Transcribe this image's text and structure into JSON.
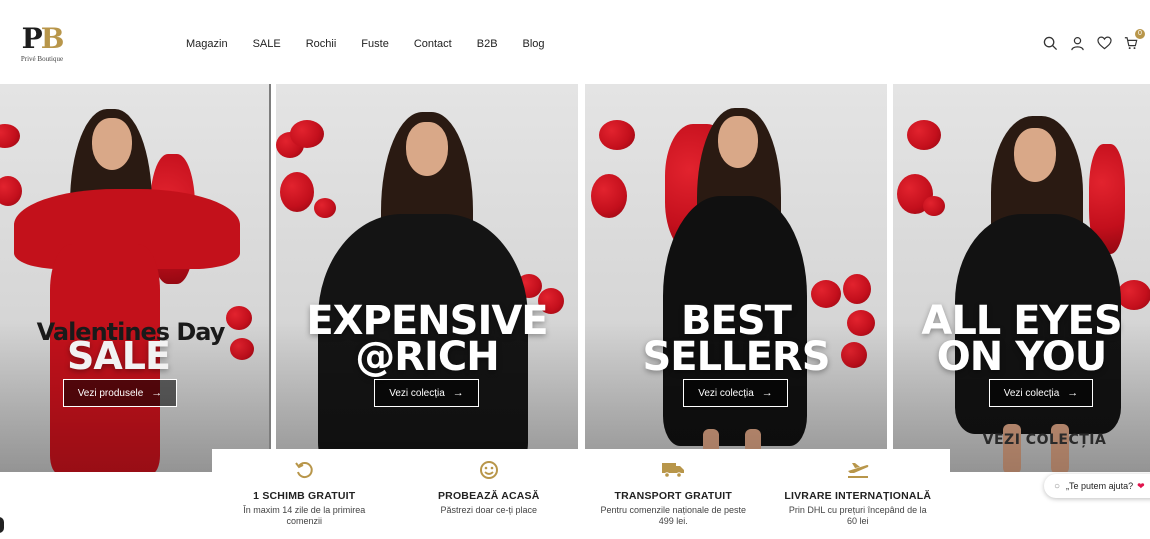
{
  "brand": {
    "mark_p": "P",
    "mark_b": "B",
    "tagline": "Privé Boutique"
  },
  "nav": {
    "items": [
      "Magazin",
      "SALE",
      "Rochii",
      "Fuste",
      "Contact",
      "B2B",
      "Blog"
    ]
  },
  "header_icons": [
    "search-icon",
    "account-icon",
    "wishlist-icon",
    "cart-icon"
  ],
  "cart": {
    "count": "0"
  },
  "hero": {
    "panels": [
      {
        "headline_top": "Valentines Day",
        "headline_bottom": "SALE",
        "cta": "Vezi produsele",
        "dress_color": "#c3111b"
      },
      {
        "headline_top": "EXPENSIVE",
        "headline_bottom": "@RICH",
        "cta": "Vezi colecția",
        "dress_color": "#141414"
      },
      {
        "headline_top": "BEST",
        "headline_bottom": "SELLERS",
        "cta": "Vezi colecția",
        "dress_color": "#101010"
      },
      {
        "headline_top": "ALL EYES",
        "headline_bottom": "ON YOU",
        "cta": "Vezi colecția",
        "dress_color": "#121212"
      }
    ],
    "faded_text": "VEZI COLECȚIA",
    "cta_arrow": "→"
  },
  "benefits": [
    {
      "icon": "return-icon",
      "title": "1 SCHIMB GRATUIT",
      "desc": "În maxim 14 zile de la primirea comenzii"
    },
    {
      "icon": "smile-icon",
      "title": "PROBEAZĂ ACASĂ",
      "desc": "Păstrezi doar ce-ți place"
    },
    {
      "icon": "truck-icon",
      "title": "TRANSPORT GRATUIT",
      "desc": "Pentru comenzile naționale de peste 499 lei."
    },
    {
      "icon": "plane-icon",
      "title": "LIVRARE INTERNAȚIONALĂ",
      "desc": "Prin DHL cu prețuri începând de la 60 lei"
    }
  ],
  "chat": {
    "label": "„Te putem ajuta?",
    "heart": "❤"
  },
  "colors": {
    "accent": "#b8964a",
    "petal": "#c30f1c"
  }
}
